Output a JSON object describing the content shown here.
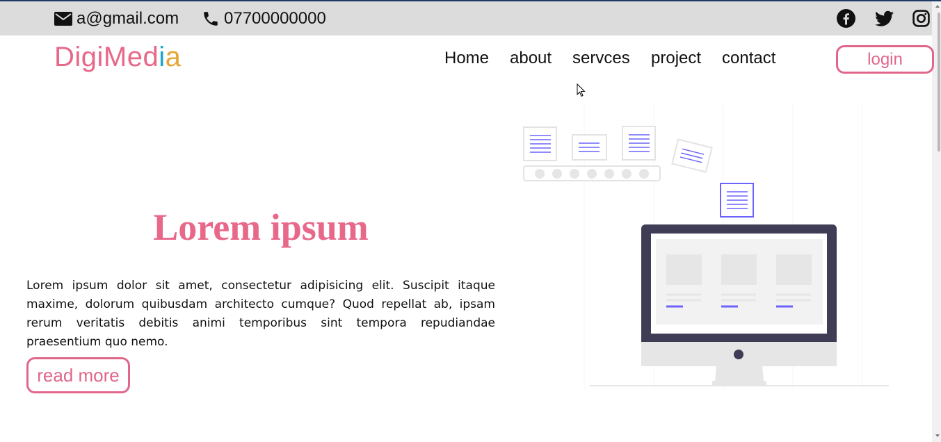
{
  "topbar": {
    "email": "a@gmail.com",
    "phone": "07700000000",
    "email_icon": "envelope-icon",
    "phone_icon": "phone-icon",
    "social": [
      "facebook-icon",
      "twitter-icon",
      "instagram-icon"
    ]
  },
  "logo": {
    "part1": "DigiMed",
    "part2": "i",
    "part3": "a"
  },
  "nav": {
    "items": [
      "Home",
      "about",
      "servces",
      "project",
      "contact"
    ],
    "login_label": "login"
  },
  "hero": {
    "title": "Lorem ipsum",
    "text": "Lorem ipsum dolor sit amet, consectetur adipisicing elit. Suscipit itaque maxime, dolorum quibusdam architecto cumque? Quod repellat ab, ipsam rerum veritatis debitis animi temporibus sint tempora repudiandae praesentium quo nemo.",
    "read_more_label": "read more"
  },
  "colors": {
    "brand_pink": "#e8688a",
    "logo_i": "#1aa4c7",
    "logo_a": "#e4a733",
    "topbar_bg": "#dcdcdc",
    "accent_purple": "#6c63ff"
  }
}
